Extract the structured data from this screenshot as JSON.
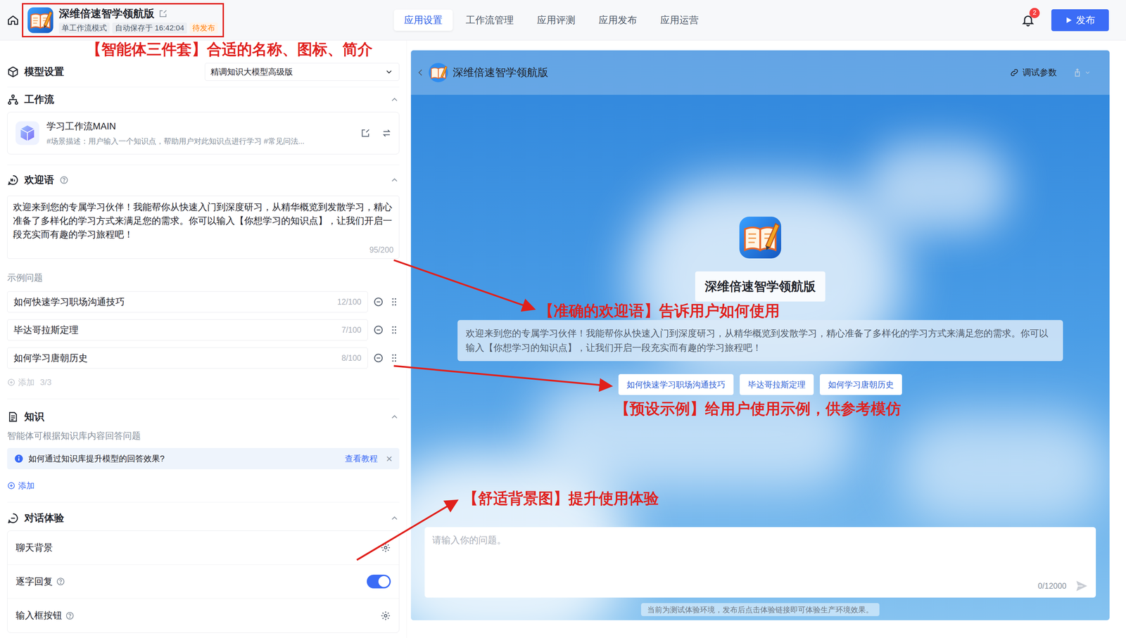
{
  "app": {
    "title": "深维倍速智学领航版",
    "mode": "单工作流模式",
    "autosave": "自动保存于 16:42:04",
    "status": "待发布"
  },
  "tabs": [
    {
      "label": "应用设置",
      "selected": true
    },
    {
      "label": "工作流管理",
      "selected": false
    },
    {
      "label": "应用评测",
      "selected": false
    },
    {
      "label": "应用发布",
      "selected": false
    },
    {
      "label": "应用运营",
      "selected": false
    }
  ],
  "notifications": {
    "count": "2"
  },
  "publish_button": "发布",
  "model": {
    "label": "模型设置",
    "value": "精调知识大模型高级版",
    "expanded": false
  },
  "workflow": {
    "label": "工作流",
    "expanded": true,
    "name": "学习工作流MAIN",
    "description": "#场景描述：用户输入一个知识点，帮助用户对此知识点进行学习 #常见问法..."
  },
  "welcome": {
    "label": "欢迎语",
    "expanded": true,
    "text": "欢迎来到您的专属学习伙伴！我能帮你从快速入门到深度研习，从精华概览到发散学习，精心准备了多样化的学习方式来满足您的需求。你可以输入【你想学习的知识点】，让我们开启一段充实而有趣的学习旅程吧！",
    "counter": "95/200"
  },
  "examples": {
    "label": "示例问题",
    "items": [
      {
        "text": "如何快速学习职场沟通技巧",
        "counter": "12/100"
      },
      {
        "text": "毕达哥拉斯定理",
        "counter": "7/100"
      },
      {
        "text": "如何学习唐朝历史",
        "counter": "8/100"
      }
    ],
    "add_label": "添加",
    "add_count": "3/3",
    "add_disabled": true
  },
  "knowledge": {
    "label": "知识",
    "expanded": true,
    "description": "智能体可根据知识库内容回答问题",
    "tip": "如何通过知识库提升模型的回答效果?",
    "tip_link": "查看教程",
    "tip_close": "×",
    "add_label": "添加"
  },
  "experience": {
    "label": "对话体验",
    "expanded": true,
    "rows": [
      {
        "label": "聊天背景",
        "kind": "settings",
        "help": false
      },
      {
        "label": "逐字回复",
        "kind": "toggle",
        "help": true,
        "on": true
      },
      {
        "label": "输入框按钮",
        "kind": "settings",
        "help": true
      }
    ]
  },
  "preview": {
    "title": "深维倍速智学领航版",
    "debug_label": "调试参数",
    "app_name": "深维倍速智学领航版",
    "welcome_text": "欢迎来到您的专属学习伙伴！我能帮你从快速入门到深度研习，从精华概览到发散学习，精心准备了多样化的学习方式来满足您的需求。你可以输入【你想学习的知识点】，让我们开启一段充实而有趣的学习旅程吧！",
    "examples": [
      "如何快速学习职场沟通技巧",
      "毕达哥拉斯定理",
      "如何学习唐朝历史"
    ],
    "input_placeholder": "请输入你的问题。",
    "input_counter": "0/12000",
    "note": "当前为测试体验环境，发布后点击体验链接即可体验生产环境效果。"
  },
  "annotations": [
    {
      "text": "【智能体三件套】合适的名称、图标、简介"
    },
    {
      "text": "【准确的欢迎语】告诉用户如何使用"
    },
    {
      "text": "【预设示例】给用户使用示例，供参考模仿"
    },
    {
      "text": "【舒适背景图】提升使用体验"
    }
  ]
}
